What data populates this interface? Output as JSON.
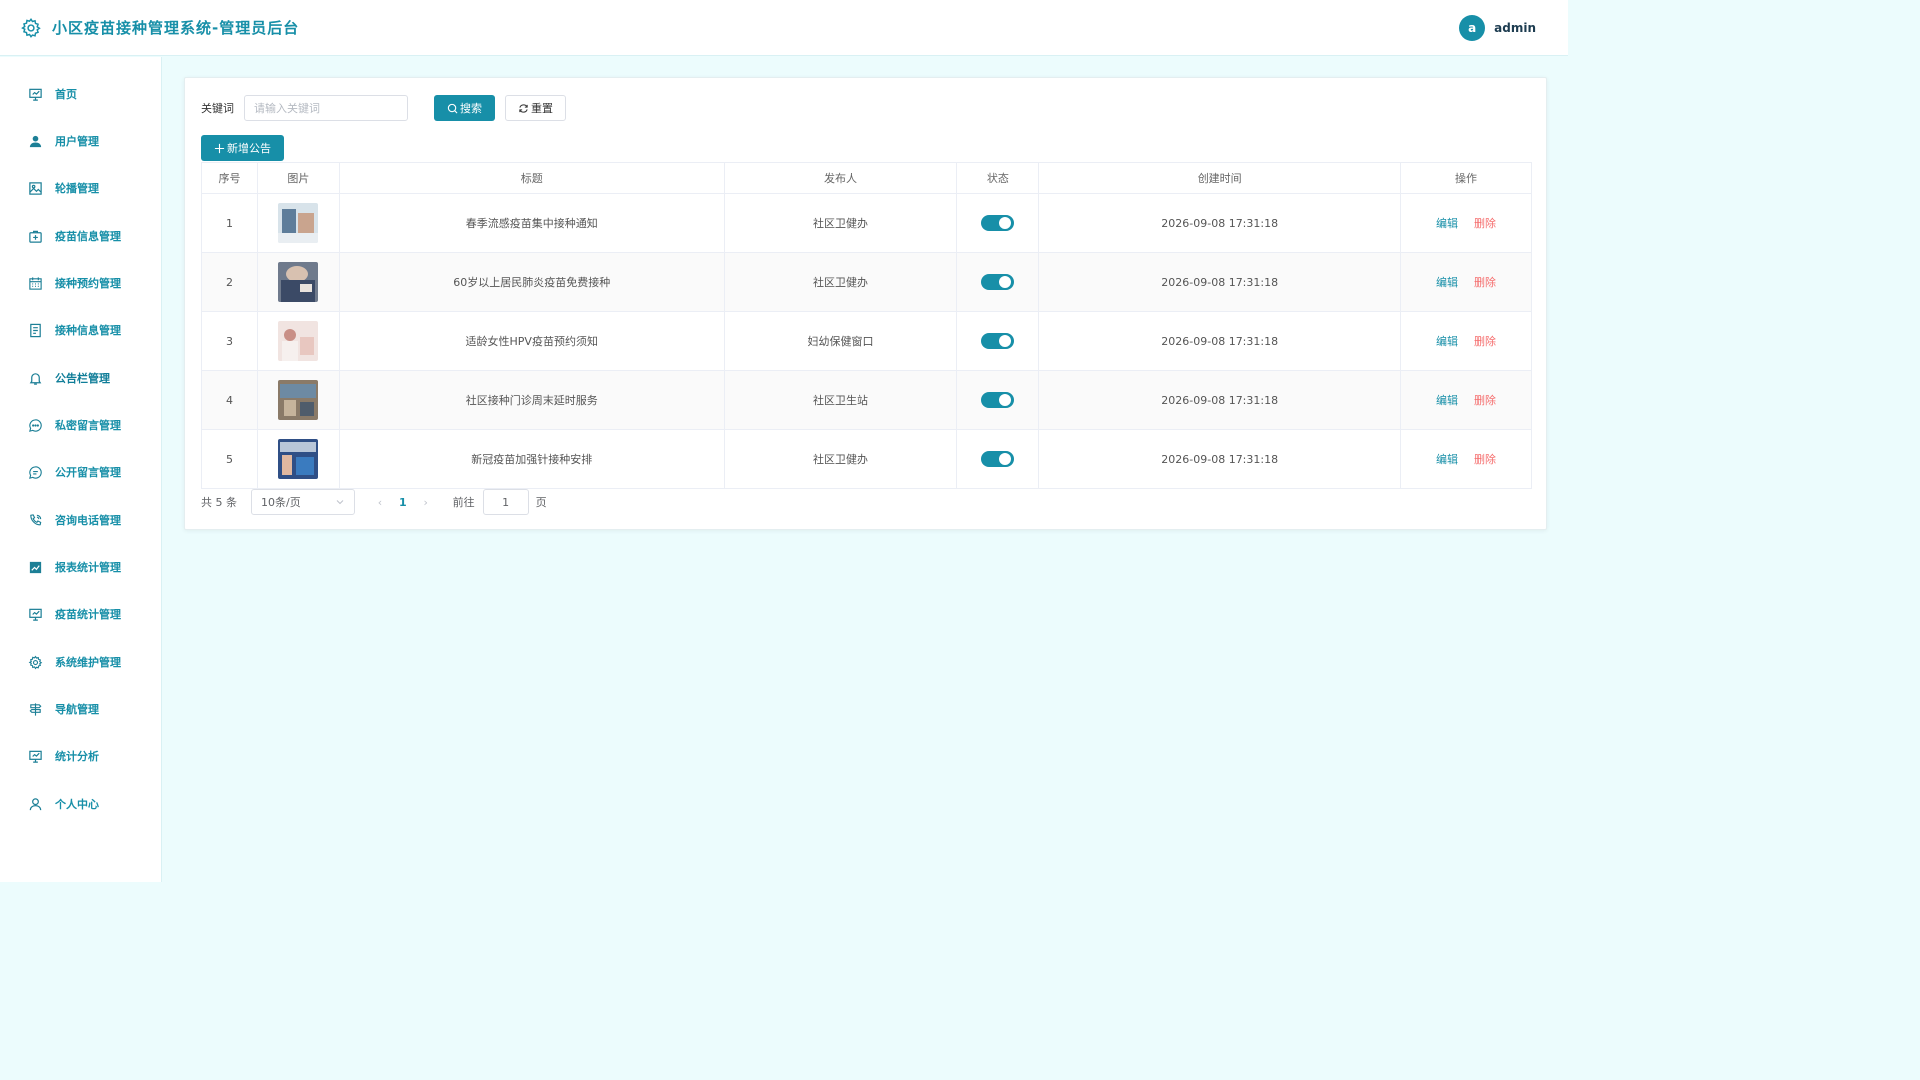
{
  "header": {
    "title": "小区疫苗接种管理系统-管理员后台",
    "brand_icon": "gear-icon",
    "user": {
      "avatar_letter": "a",
      "name": "admin"
    }
  },
  "sidebar": {
    "items": [
      {
        "label": "首页",
        "icon": "presentation-icon"
      },
      {
        "label": "用户管理",
        "icon": "user-icon"
      },
      {
        "label": "轮播管理",
        "icon": "image-icon"
      },
      {
        "label": "疫苗信息管理",
        "icon": "first-aid-icon"
      },
      {
        "label": "接种预约管理",
        "icon": "calendar-icon"
      },
      {
        "label": "接种信息管理",
        "icon": "document-icon"
      },
      {
        "label": "公告栏管理",
        "icon": "bell-icon",
        "active": true
      },
      {
        "label": "私密留言管理",
        "icon": "chat-dots-icon"
      },
      {
        "label": "公开留言管理",
        "icon": "chat-lines-icon"
      },
      {
        "label": "咨询电话管理",
        "icon": "phone-icon"
      },
      {
        "label": "报表统计管理",
        "icon": "chart-icon"
      },
      {
        "label": "疫苗统计管理",
        "icon": "presentation-icon"
      },
      {
        "label": "系统维护管理",
        "icon": "gear-icon"
      },
      {
        "label": "导航管理",
        "icon": "signpost-icon"
      },
      {
        "label": "统计分析",
        "icon": "presentation-icon"
      },
      {
        "label": "个人中心",
        "icon": "user-outline-icon"
      }
    ]
  },
  "search": {
    "label": "关键词",
    "placeholder": "请输入关键词",
    "search_button": "搜索",
    "reset_button": "重置"
  },
  "add_button": "新增公告",
  "table": {
    "columns": [
      "序号",
      "图片",
      "标题",
      "发布人",
      "状态",
      "创建时间",
      "操作"
    ],
    "rows": [
      {
        "index": "1",
        "title": "春季流感疫苗集中接种通知",
        "publisher": "社区卫健办",
        "status_on": true,
        "created": "2026-09-08 17:31:18"
      },
      {
        "index": "2",
        "title": "60岁以上居民肺炎疫苗免费接种",
        "publisher": "社区卫健办",
        "status_on": true,
        "created": "2026-09-08 17:31:18"
      },
      {
        "index": "3",
        "title": "适龄女性HPV疫苗预约须知",
        "publisher": "妇幼保健窗口",
        "status_on": true,
        "created": "2026-09-08 17:31:18"
      },
      {
        "index": "4",
        "title": "社区接种门诊周末延时服务",
        "publisher": "社区卫生站",
        "status_on": true,
        "created": "2026-09-08 17:31:18"
      },
      {
        "index": "5",
        "title": "新冠疫苗加强针接种安排",
        "publisher": "社区卫健办",
        "status_on": true,
        "created": "2026-09-08 17:31:18"
      }
    ],
    "actions": {
      "edit": "编辑",
      "delete": "删除"
    }
  },
  "pagination": {
    "total_text": "共 5 条",
    "page_size": "10条/页",
    "current_page": "1",
    "goto_label": "前往",
    "goto_value": "1",
    "page_unit": "页"
  },
  "colors": {
    "accent": "#178fa8",
    "danger": "#f56c6c",
    "background": "#ecfcfd"
  }
}
